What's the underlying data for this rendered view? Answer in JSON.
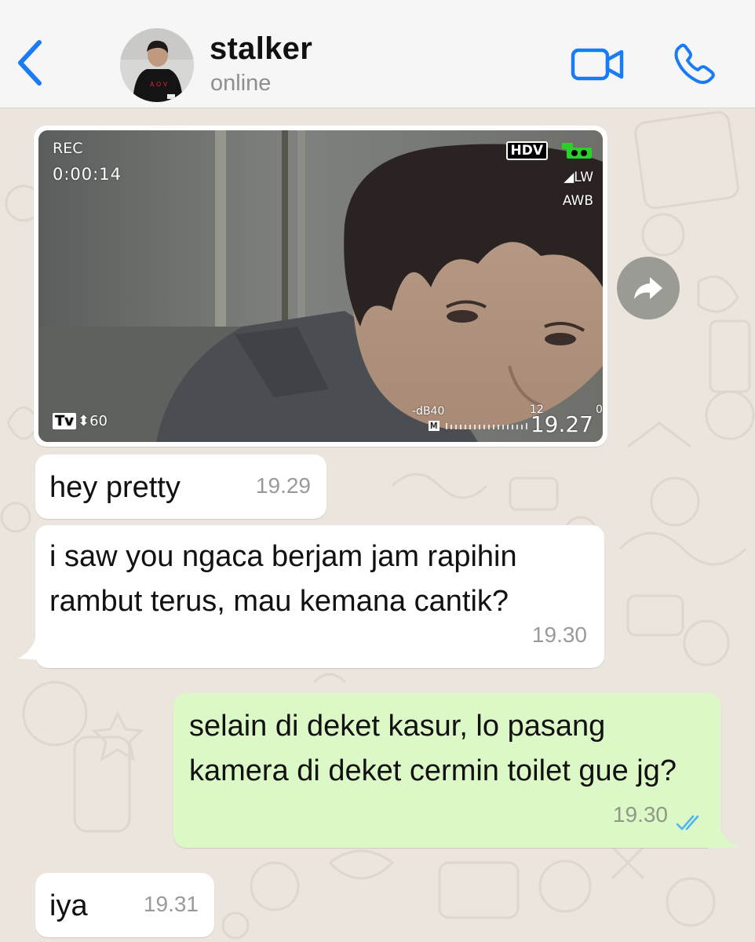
{
  "header": {
    "contact_name": "stalker",
    "status": "online",
    "accent_color": "#1a7cf5"
  },
  "icons": {
    "back": "chevron-left-icon",
    "video": "video-camera-icon",
    "call": "phone-icon",
    "forward": "forward-arrow-icon",
    "read": "double-check-icon"
  },
  "photo_overlay": {
    "rec": "REC",
    "timecode": "0:00:14",
    "hdv": "HDV",
    "lw": "◢LW",
    "awb": "AWB",
    "tv_mode": "Tv",
    "tv_value": "⬍60",
    "db": "-dB40",
    "m": "M",
    "mark_12": "12",
    "mark_0": "0",
    "stamp": "19.27"
  },
  "messages": [
    {
      "direction": "incoming",
      "text": "hey pretty",
      "time": "19.29"
    },
    {
      "direction": "incoming",
      "text": "i saw you ngaca berjam jam rapihin rambut terus, mau kemana cantik?",
      "time": "19.30"
    },
    {
      "direction": "outgoing",
      "text": "selain di deket kasur, lo pasang kamera di deket cermin toilet gue jg?",
      "time": "19.30",
      "read": true
    },
    {
      "direction": "incoming",
      "text": "iya",
      "time": "19.31"
    }
  ],
  "colors": {
    "chat_bg": "#ece5dd",
    "incoming_bubble": "#ffffff",
    "outgoing_bubble": "#dcf8c6",
    "read_ticks": "#4fb6ec"
  }
}
